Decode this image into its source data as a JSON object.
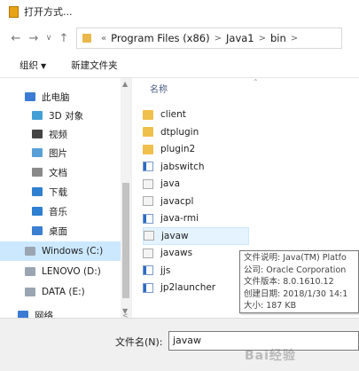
{
  "window": {
    "title": "打开方式..."
  },
  "nav": {
    "back": "←",
    "forward": "→",
    "recent": "∨",
    "up": "↑",
    "overflow": "«",
    "breadcrumb": [
      "Program Files (x86)",
      "Java1",
      "bin"
    ],
    "separator": ">"
  },
  "commands": {
    "organize": "组织",
    "organize_caret": "▼",
    "new_folder": "新建文件夹"
  },
  "sidebar": {
    "items": [
      {
        "label": "此电脑",
        "icon": "computer-icon",
        "color": "#3b7bd4"
      },
      {
        "label": "3D 对象",
        "icon": "3d-objects-icon",
        "color": "#43a0d6"
      },
      {
        "label": "视频",
        "icon": "video-icon",
        "color": "#444444"
      },
      {
        "label": "图片",
        "icon": "pictures-icon",
        "color": "#5aa0d8"
      },
      {
        "label": "文档",
        "icon": "documents-icon",
        "color": "#8a8a8a"
      },
      {
        "label": "下载",
        "icon": "downloads-icon",
        "color": "#2f80d1"
      },
      {
        "label": "音乐",
        "icon": "music-icon",
        "color": "#2f80d1"
      },
      {
        "label": "桌面",
        "icon": "desktop-icon",
        "color": "#3a7fd0"
      },
      {
        "label": "Windows (C:)",
        "icon": "drive-icon",
        "color": "#9aa5b1",
        "selected": true
      },
      {
        "label": "LENOVO (D:)",
        "icon": "drive-icon",
        "color": "#9aa5b1"
      },
      {
        "label": "DATA (E:)",
        "icon": "drive-icon",
        "color": "#9aa5b1"
      },
      {
        "label": "网络",
        "icon": "network-icon",
        "color": "#3b7bd4"
      }
    ]
  },
  "filelist": {
    "column_name": "名称",
    "files": [
      {
        "name": "client",
        "type": "folder"
      },
      {
        "name": "dtplugin",
        "type": "folder"
      },
      {
        "name": "plugin2",
        "type": "folder"
      },
      {
        "name": "jabswitch",
        "type": "exe"
      },
      {
        "name": "java",
        "type": "java"
      },
      {
        "name": "javacpl",
        "type": "java"
      },
      {
        "name": "java-rmi",
        "type": "exe"
      },
      {
        "name": "javaw",
        "type": "java",
        "hover": true
      },
      {
        "name": "javaws",
        "type": "java"
      },
      {
        "name": "jjs",
        "type": "exe"
      },
      {
        "name": "jp2launcher",
        "type": "exe"
      }
    ]
  },
  "tooltip": {
    "description": "文件说明: Java(TM) Platfo",
    "company": "公司: Oracle Corporation",
    "version": "文件版本: 8.0.1610.12",
    "created": "创建日期: 2018/1/30 14:1",
    "size": "大小: 187 KB"
  },
  "footer": {
    "filename_label": "文件名(N):",
    "filename_value": "javaw"
  },
  "watermark": "Bai经验"
}
